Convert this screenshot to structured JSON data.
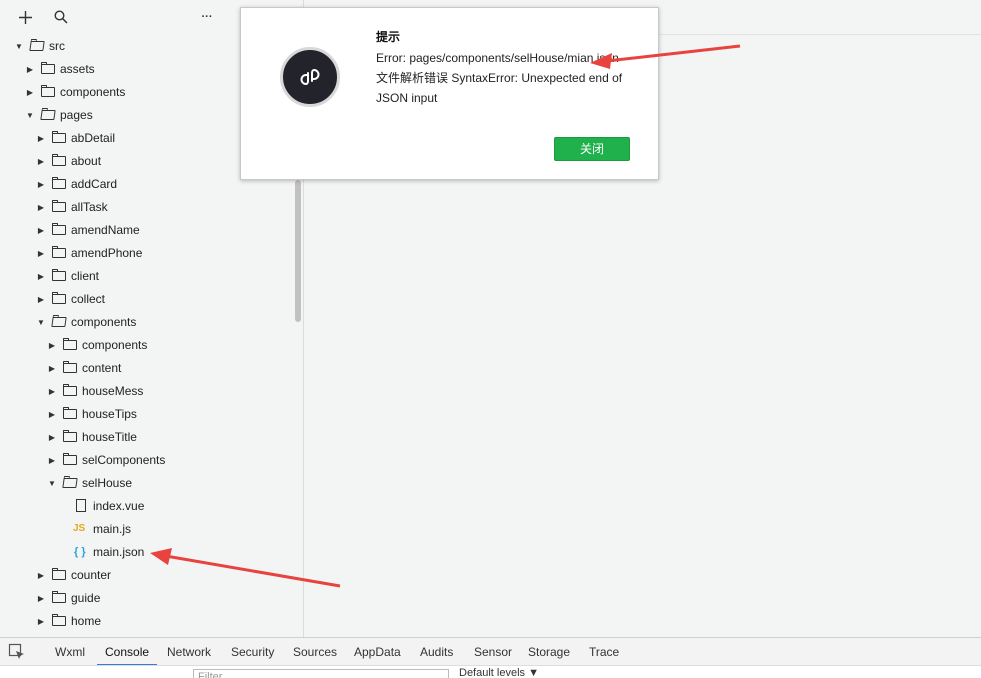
{
  "sidebar": {
    "toolbar": {
      "add_icon": "+",
      "search_icon": "search",
      "more_icon": "···"
    },
    "tree": [
      {
        "label": "src",
        "type": "folder",
        "depth": 0,
        "open": true
      },
      {
        "label": "assets",
        "type": "folder",
        "depth": 1,
        "open": false
      },
      {
        "label": "components",
        "type": "folder",
        "depth": 1,
        "open": false
      },
      {
        "label": "pages",
        "type": "folder",
        "depth": 1,
        "open": true
      },
      {
        "label": "abDetail",
        "type": "folder",
        "depth": 2,
        "open": false
      },
      {
        "label": "about",
        "type": "folder",
        "depth": 2,
        "open": false
      },
      {
        "label": "addCard",
        "type": "folder",
        "depth": 2,
        "open": false
      },
      {
        "label": "allTask",
        "type": "folder",
        "depth": 2,
        "open": false
      },
      {
        "label": "amendName",
        "type": "folder",
        "depth": 2,
        "open": false
      },
      {
        "label": "amendPhone",
        "type": "folder",
        "depth": 2,
        "open": false
      },
      {
        "label": "client",
        "type": "folder",
        "depth": 2,
        "open": false
      },
      {
        "label": "collect",
        "type": "folder",
        "depth": 2,
        "open": false
      },
      {
        "label": "components",
        "type": "folder",
        "depth": 2,
        "open": true
      },
      {
        "label": "components",
        "type": "folder",
        "depth": 3,
        "open": false
      },
      {
        "label": "content",
        "type": "folder",
        "depth": 3,
        "open": false
      },
      {
        "label": "houseMess",
        "type": "folder",
        "depth": 3,
        "open": false
      },
      {
        "label": "houseTips",
        "type": "folder",
        "depth": 3,
        "open": false
      },
      {
        "label": "houseTitle",
        "type": "folder",
        "depth": 3,
        "open": false
      },
      {
        "label": "selComponents",
        "type": "folder",
        "depth": 3,
        "open": false
      },
      {
        "label": "selHouse",
        "type": "folder",
        "depth": 3,
        "open": true
      },
      {
        "label": "index.vue",
        "type": "file",
        "depth": 4
      },
      {
        "label": "main.js",
        "type": "js",
        "depth": 4,
        "icon_text": "JS"
      },
      {
        "label": "main.json",
        "type": "json",
        "depth": 4,
        "icon_text": "{ }"
      },
      {
        "label": "counter",
        "type": "folder",
        "depth": 2,
        "open": false
      },
      {
        "label": "guide",
        "type": "folder",
        "depth": 2,
        "open": false
      },
      {
        "label": "home",
        "type": "folder",
        "depth": 2,
        "open": false
      }
    ]
  },
  "dialog": {
    "title": "提示",
    "message": "Error: pages/components/selHouse/mian.json 文件解析错误 SyntaxError: Unexpected end of JSON input",
    "close_label": "关闭"
  },
  "bottom_tabs": {
    "items": [
      "Wxml",
      "Console",
      "Network",
      "Security",
      "Sources",
      "AppData",
      "Audits",
      "Sensor",
      "Storage",
      "Trace"
    ],
    "active": "Console"
  },
  "filter": {
    "placeholder": "Filter",
    "level_label": "Default levels ▼"
  },
  "colors": {
    "accent": "#3879d9",
    "button_green": "#20b14d",
    "annotation_red": "#e8433e",
    "js_icon": "#e6a817",
    "json_icon": "#29a3d6"
  }
}
